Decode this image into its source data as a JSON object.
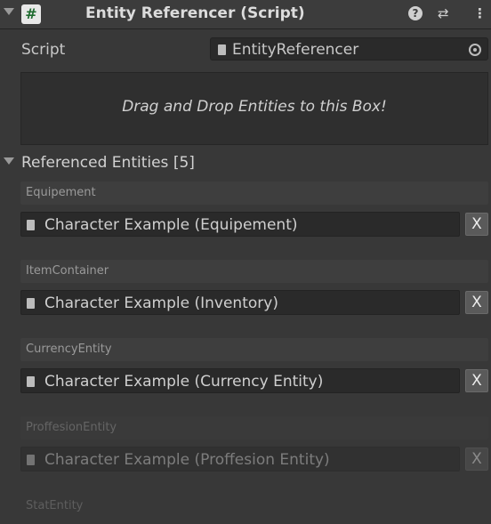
{
  "header": {
    "title": "Entity Referencer (Script)",
    "script_glyph": "#",
    "help_glyph": "?",
    "presets_glyph": "⇄",
    "menu_glyph": "⋮"
  },
  "script_row": {
    "label": "Script",
    "value": "EntityReferencer"
  },
  "drop_box": {
    "text": "Drag and Drop Entities to this Box!"
  },
  "referenced": {
    "title": "Referenced Entities [5]",
    "entries": [
      {
        "label": "Equipement",
        "value": "Character Example (Equipement)",
        "remove": "X"
      },
      {
        "label": "ItemContainer",
        "value": "Character Example (Inventory)",
        "remove": "X"
      },
      {
        "label": "CurrencyEntity",
        "value": "Character Example (Currency Entity)",
        "remove": "X"
      },
      {
        "label": "ProffesionEntity",
        "value": "Character Example (Proffesion Entity)",
        "remove": "X"
      }
    ],
    "partial_label": "StatEntity"
  },
  "icons": [
    "foldout-arrow-icon",
    "script-icon",
    "help-icon",
    "presets-icon",
    "menu-icon",
    "script-file-icon",
    "object-picker-icon"
  ]
}
